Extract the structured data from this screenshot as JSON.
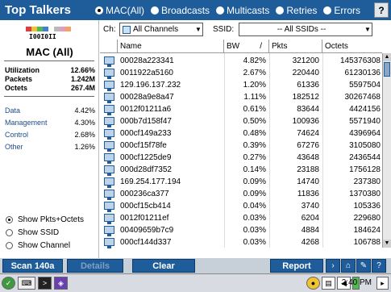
{
  "window": {
    "title": "Top Talkers",
    "help_label": "?",
    "modes": [
      {
        "label": "MAC(All)",
        "selected": true
      },
      {
        "label": "Broadcasts",
        "selected": false
      },
      {
        "label": "Multicasts",
        "selected": false
      },
      {
        "label": "Retries",
        "selected": false
      },
      {
        "label": "Errors",
        "selected": false
      }
    ]
  },
  "colors": {
    "accent": "#1f5d9a",
    "swatches": [
      "#e23b3b",
      "#f1c232",
      "#52b852",
      "#3f7fd4",
      "#ffffff",
      "#b9b9b9",
      "#e59ac4",
      "#f4a261"
    ]
  },
  "sidebar": {
    "logo_text": "I00I0II",
    "mode_title": "MAC (All)",
    "stats": [
      {
        "label": "Utilization",
        "value": "12.66%"
      },
      {
        "label": "Packets",
        "value": "1.242M"
      },
      {
        "label": "Octets",
        "value": "267.4M"
      }
    ],
    "categories": [
      {
        "label": "Data",
        "value": "4.42%"
      },
      {
        "label": "Management",
        "value": "4.30%"
      },
      {
        "label": "Control",
        "value": "2.68%"
      },
      {
        "label": "Other",
        "value": "1.26%"
      }
    ],
    "show_options": [
      {
        "label": "Show Pkts+Octets",
        "selected": true
      },
      {
        "label": "Show SSID",
        "selected": false
      },
      {
        "label": "Show Channel",
        "selected": false
      }
    ]
  },
  "filters": {
    "channel_label": "Ch:",
    "channel_value": "All Channels",
    "ssid_label": "SSID:",
    "ssid_value": "-- All SSIDs --"
  },
  "table": {
    "headers": {
      "name": "Name",
      "bw": "BW",
      "sort": "/",
      "pkts": "Pkts",
      "octets": "Octets"
    },
    "rows": [
      {
        "name": "00028a223341",
        "bw": "4.82%",
        "pkts": "321200",
        "octets": "145376308"
      },
      {
        "name": "0011922a5160",
        "bw": "2.67%",
        "pkts": "220440",
        "octets": "61230136"
      },
      {
        "name": "129.196.137.232",
        "bw": "1.20%",
        "pkts": "61336",
        "octets": "5597504"
      },
      {
        "name": "00028a9e8a47",
        "bw": "1.11%",
        "pkts": "182512",
        "octets": "30267468"
      },
      {
        "name": "0012f01211a6",
        "bw": "0.61%",
        "pkts": "83644",
        "octets": "4424156"
      },
      {
        "name": "000b7d158f47",
        "bw": "0.50%",
        "pkts": "100936",
        "octets": "5571940"
      },
      {
        "name": "000cf149a233",
        "bw": "0.48%",
        "pkts": "74624",
        "octets": "4396964"
      },
      {
        "name": "000cf15f78fe",
        "bw": "0.39%",
        "pkts": "67276",
        "octets": "3105080"
      },
      {
        "name": "000cf1225de9",
        "bw": "0.27%",
        "pkts": "43648",
        "octets": "2436544"
      },
      {
        "name": "000d28df7352",
        "bw": "0.14%",
        "pkts": "23188",
        "octets": "1756128"
      },
      {
        "name": "169.254.177.194",
        "bw": "0.09%",
        "pkts": "14740",
        "octets": "237380"
      },
      {
        "name": "000236ca377",
        "bw": "0.09%",
        "pkts": "11836",
        "octets": "1370380"
      },
      {
        "name": "000cf15cb414",
        "bw": "0.04%",
        "pkts": "3740",
        "octets": "105336"
      },
      {
        "name": "0012f01211ef",
        "bw": "0.03%",
        "pkts": "6204",
        "octets": "229680"
      },
      {
        "name": "00409659b7c9",
        "bw": "0.03%",
        "pkts": "4884",
        "octets": "184624"
      },
      {
        "name": "000cf144d337",
        "bw": "0.03%",
        "pkts": "4268",
        "octets": "106788"
      }
    ]
  },
  "buttons": {
    "scan": "Scan 140a",
    "details": "Details",
    "clear": "Clear",
    "report": "Report"
  },
  "taskbar": {
    "clock": "2:40 PM"
  }
}
